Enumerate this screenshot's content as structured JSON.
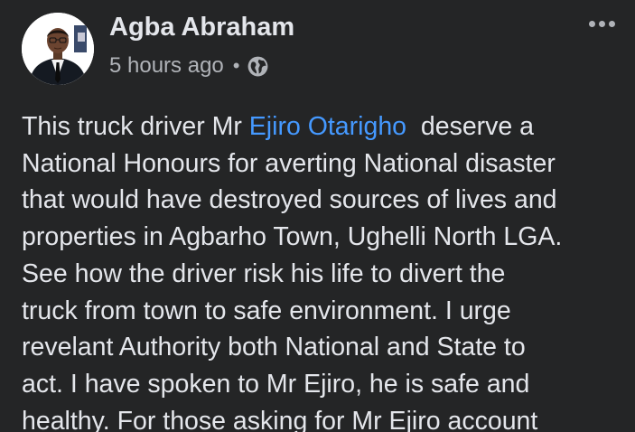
{
  "post": {
    "author": {
      "name": "Agba Abraham",
      "avatar_icon": "profile-photo-man-in-suit"
    },
    "timestamp": "5 hours ago",
    "separator": "•",
    "privacy_icon": "globe-icon",
    "more_icon": "more-options-icon",
    "text": {
      "line_1_before": "This truck driver Mr ",
      "mention": "Ejiro Otarigho",
      "line_1_after": "  deserve a",
      "line_2": "National Honours for averting National disaster",
      "line_3": "that would have destroyed sources of lives and",
      "line_4": "properties in Agbarho Town, Ughelli North LGA.",
      "line_5": "See how the driver risk his life to divert the",
      "line_6": "truck from town to safe environment. I urge",
      "line_7": "revelant Authority both National and State to",
      "line_8": "act. I have spoken to Mr Ejiro, he is safe and",
      "line_9": "healthy. For those asking for Mr Ejiro account"
    }
  },
  "colors": {
    "background": "#242526",
    "primary_text": "#e4e6eb",
    "secondary_text": "#b0b3b8",
    "link": "#4599ff"
  }
}
